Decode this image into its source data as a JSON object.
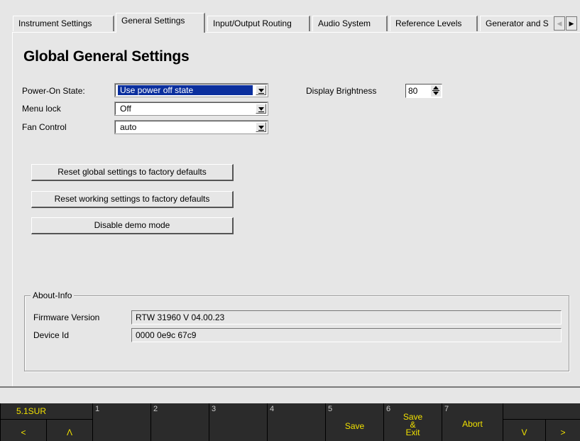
{
  "tabs": [
    {
      "label": "Instrument Settings"
    },
    {
      "label": "General Settings",
      "active": true
    },
    {
      "label": "Input/Output Routing"
    },
    {
      "label": "Audio System"
    },
    {
      "label": "Reference Levels"
    },
    {
      "label": "Generator and S"
    }
  ],
  "tab_scroll": {
    "left": "◀",
    "right": "▶"
  },
  "page": {
    "title": "Global General Settings"
  },
  "settings": {
    "power_on_state": {
      "label": "Power-On State:",
      "value": "Use power off state"
    },
    "menu_lock": {
      "label": "Menu lock",
      "value": "Off"
    },
    "fan_control": {
      "label": "Fan Control",
      "value": "auto"
    },
    "display_brightness": {
      "label": "Display Brightness",
      "value": "80"
    }
  },
  "buttons": {
    "reset_global": "Reset global settings to factory defaults",
    "reset_working": "Reset working settings to factory defaults",
    "disable_demo": "Disable demo mode"
  },
  "about": {
    "legend": "About-Info",
    "firmware_label": "Firmware Version",
    "firmware_value": "RTW 31960 V 04.00.23",
    "device_label": "Device Id",
    "device_value": "0000 0e9c 67c9"
  },
  "softkeys": {
    "mode": "5.1SUR",
    "n1": "1",
    "n2": "2",
    "n3": "3",
    "n4": "4",
    "n5": "5",
    "n6": "6",
    "n7": "7",
    "save": "Save",
    "save_exit": "Save\n&\nExit",
    "abort": "Abort",
    "left": "<",
    "up": "Λ",
    "down": "V",
    "right": ">"
  },
  "colors": {
    "softkey_text": "#f0e000",
    "selection": "#0b2f9e"
  }
}
